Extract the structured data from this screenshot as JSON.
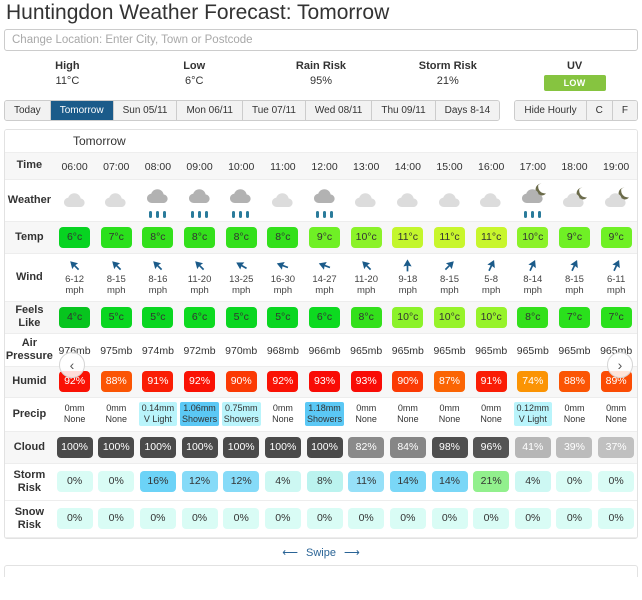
{
  "header": {
    "title": "Huntingdon Weather Forecast: Tomorrow",
    "location_placeholder": "Change Location: Enter City, Town or Postcode",
    "location_value": ""
  },
  "summary": [
    {
      "label": "High",
      "value": "11°C"
    },
    {
      "label": "Low",
      "value": "6°C"
    },
    {
      "label": "Rain Risk",
      "value": "95%"
    },
    {
      "label": "Storm Risk",
      "value": "21%"
    },
    {
      "label": "UV",
      "value": "LOW",
      "badge_color": "#86c440"
    }
  ],
  "tabs": {
    "days": [
      {
        "label": "Today",
        "active": false
      },
      {
        "label": "Tomorrow",
        "active": true
      },
      {
        "label": "Sun 05/11",
        "active": false
      },
      {
        "label": "Mon 06/11",
        "active": false
      },
      {
        "label": "Tue 07/11",
        "active": false
      },
      {
        "label": "Wed 08/11",
        "active": false
      },
      {
        "label": "Thu 09/11",
        "active": false
      },
      {
        "label": "Days 8-14",
        "active": false
      }
    ],
    "controls": [
      {
        "label": "Hide Hourly",
        "active": false
      },
      {
        "label": "C",
        "active": false
      },
      {
        "label": "F",
        "active": false
      }
    ]
  },
  "table": {
    "day_label": "Tomorrow",
    "row_labels": {
      "time": "Time",
      "weather": "Weather",
      "temp": "Temp",
      "wind": "Wind",
      "feels_like": "Feels Like",
      "air_pressure": "Air Pressure",
      "humid": "Humid",
      "precip": "Precip",
      "cloud": "Cloud",
      "storm_risk": "Storm Risk",
      "snow_risk": "Snow Risk"
    },
    "nav": {
      "prev": "‹",
      "next": "›"
    },
    "swipe_label": "Swipe",
    "swipe_left_arrow": "⟵",
    "swipe_right_arrow": "⟶"
  },
  "chart_data": {
    "type": "table",
    "title": "Huntingdon Hourly Weather Forecast: Tomorrow",
    "columns": [
      "06:00",
      "07:00",
      "08:00",
      "09:00",
      "10:00",
      "11:00",
      "12:00",
      "13:00",
      "14:00",
      "15:00",
      "16:00",
      "17:00",
      "18:00",
      "19:00"
    ],
    "rows": {
      "weather": [
        {
          "icon": "cloud-light",
          "night": false,
          "rain": false
        },
        {
          "icon": "cloud-light",
          "night": false,
          "rain": false
        },
        {
          "icon": "cloud-rain",
          "night": false,
          "rain": true
        },
        {
          "icon": "cloud-rain",
          "night": false,
          "rain": true
        },
        {
          "icon": "cloud-rain",
          "night": false,
          "rain": true
        },
        {
          "icon": "cloud-light",
          "night": false,
          "rain": false
        },
        {
          "icon": "cloud-rain",
          "night": false,
          "rain": true
        },
        {
          "icon": "cloud-light",
          "night": false,
          "rain": false
        },
        {
          "icon": "cloud-light",
          "night": false,
          "rain": false
        },
        {
          "icon": "cloud-light",
          "night": false,
          "rain": false
        },
        {
          "icon": "cloud-light",
          "night": false,
          "rain": false
        },
        {
          "icon": "cloud-moon-rain",
          "night": true,
          "rain": true
        },
        {
          "icon": "cloud-moon",
          "night": true,
          "rain": false
        },
        {
          "icon": "cloud-moon",
          "night": true,
          "rain": false
        }
      ],
      "temp": {
        "values": [
          "6°c",
          "7°c",
          "8°c",
          "8°c",
          "8°c",
          "8°c",
          "9°c",
          "10°c",
          "11°c",
          "11°c",
          "11°c",
          "10°c",
          "9°c",
          "9°c"
        ],
        "colors": [
          "#07d321",
          "#2ae01c",
          "#33e01b",
          "#33e01b",
          "#33e01b",
          "#33e01b",
          "#6ff025",
          "#8bf229",
          "#c3f62c",
          "#c8f62c",
          "#c8f62c",
          "#8bf229",
          "#6ff025",
          "#6ff025"
        ]
      },
      "wind": {
        "speeds": [
          "6-12 mph",
          "8-15 mph",
          "8-16 mph",
          "11-20 mph",
          "13-25 mph",
          "16-30 mph",
          "14-27 mph",
          "11-20 mph",
          "9-18 mph",
          "8-15 mph",
          "5-8 mph",
          "8-14 mph",
          "8-15 mph",
          "6-11 mph"
        ],
        "directions_deg": [
          315,
          315,
          315,
          315,
          300,
          290,
          290,
          315,
          0,
          45,
          25,
          25,
          25,
          25
        ]
      },
      "feels_like": {
        "values": [
          "4°c",
          "5°c",
          "5°c",
          "6°c",
          "5°c",
          "5°c",
          "6°c",
          "8°c",
          "10°c",
          "10°c",
          "10°c",
          "8°c",
          "7°c",
          "7°c"
        ],
        "colors": [
          "#07c41e",
          "#09d620",
          "#09d620",
          "#0dda20",
          "#09d620",
          "#09d620",
          "#0dda20",
          "#33e01b",
          "#8bf229",
          "#97f32a",
          "#97f32a",
          "#33e01b",
          "#2ae01c",
          "#2ae01c"
        ]
      },
      "air_pressure": [
        "976mb",
        "975mb",
        "974mb",
        "972mb",
        "970mb",
        "968mb",
        "966mb",
        "965mb",
        "965mb",
        "965mb",
        "965mb",
        "965mb",
        "965mb",
        "965mb"
      ],
      "humid": {
        "values": [
          "92%",
          "88%",
          "91%",
          "92%",
          "90%",
          "92%",
          "93%",
          "93%",
          "90%",
          "87%",
          "91%",
          "74%",
          "88%",
          "89%"
        ],
        "colors": [
          "#fa1205",
          "#fb5504",
          "#fa1d05",
          "#fa1205",
          "#fb3a04",
          "#fa1205",
          "#f90c06",
          "#f90c06",
          "#fb3a04",
          "#fb6504",
          "#fa1d05",
          "#fb9404",
          "#fb5504",
          "#fb4c04"
        ]
      },
      "precip": {
        "amounts": [
          "0mm",
          "0mm",
          "0.14mm",
          "1.06mm",
          "0.75mm",
          "0mm",
          "1.18mm",
          "0mm",
          "0mm",
          "0mm",
          "0mm",
          "0.12mm",
          "0mm",
          "0mm"
        ],
        "types": [
          "None",
          "None",
          "V Light",
          "Showers",
          "Showers",
          "None",
          "Showers",
          "None",
          "None",
          "None",
          "None",
          "V Light",
          "None",
          "None"
        ],
        "colors": [
          "transparent",
          "transparent",
          "#b9f4fb",
          "#5bc8f5",
          "#b9f4fb",
          "transparent",
          "#5bc8f5",
          "transparent",
          "transparent",
          "transparent",
          "transparent",
          "#b9f4fb",
          "transparent",
          "transparent"
        ]
      },
      "cloud": {
        "values": [
          "100%",
          "100%",
          "100%",
          "100%",
          "100%",
          "100%",
          "100%",
          "82%",
          "84%",
          "98%",
          "96%",
          "41%",
          "39%",
          "37%"
        ],
        "colors": [
          "#4a4a4a",
          "#4a4a4a",
          "#4a4a4a",
          "#4a4a4a",
          "#4a4a4a",
          "#4a4a4a",
          "#4a4a4a",
          "#8a8a8a",
          "#868686",
          "#4f4f4f",
          "#545454",
          "#b6b6b6",
          "#bcbcbc",
          "#c0c0c0"
        ]
      },
      "storm_risk": {
        "values": [
          "0%",
          "0%",
          "16%",
          "12%",
          "12%",
          "4%",
          "8%",
          "11%",
          "14%",
          "14%",
          "21%",
          "4%",
          "0%",
          "0%"
        ],
        "colors": [
          "#d9fcf5",
          "#d9fcf5",
          "#6cd3f7",
          "#86dbf8",
          "#86dbf8",
          "#cdf8f3",
          "#bbf3ef",
          "#96e0f8",
          "#7ad7f7",
          "#7ad7f7",
          "#92f08d",
          "#cdf8f3",
          "#d9fcf5",
          "#d9fcf5"
        ]
      },
      "snow_risk": {
        "values": [
          "0%",
          "0%",
          "0%",
          "0%",
          "0%",
          "0%",
          "0%",
          "0%",
          "0%",
          "0%",
          "0%",
          "0%",
          "0%",
          "0%"
        ],
        "colors": [
          "#d9fcf5",
          "#d9fcf5",
          "#d9fcf5",
          "#d9fcf5",
          "#d9fcf5",
          "#d9fcf5",
          "#d9fcf5",
          "#d9fcf5",
          "#d9fcf5",
          "#d9fcf5",
          "#d9fcf5",
          "#d9fcf5",
          "#d9fcf5",
          "#d9fcf5"
        ]
      }
    }
  }
}
